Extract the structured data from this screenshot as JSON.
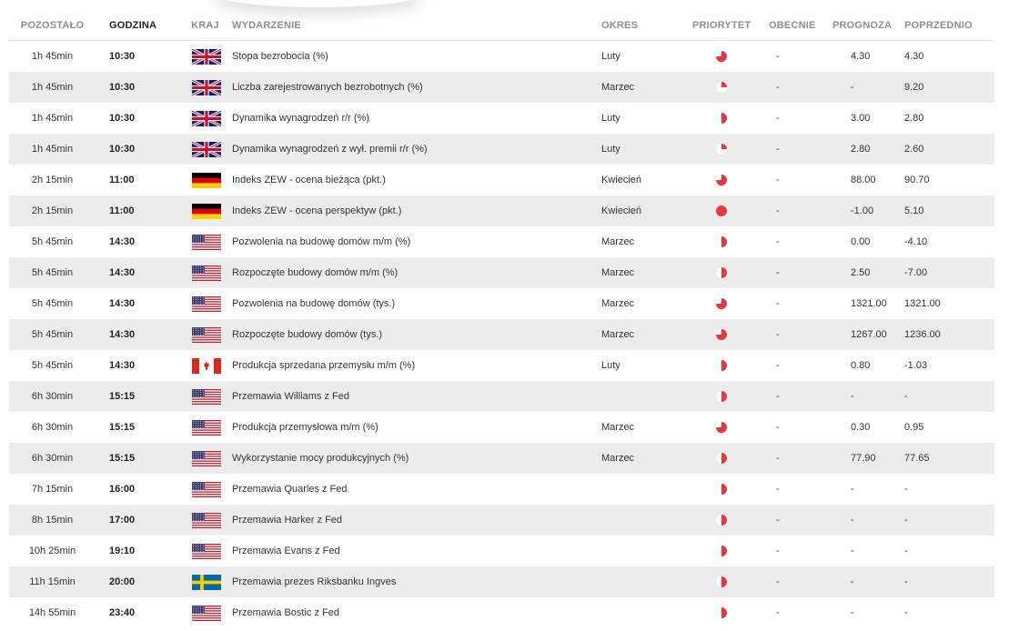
{
  "headers": {
    "remaining": "POZOSTAŁO",
    "time": "GODZINA",
    "country": "KRAJ",
    "event": "WYDARZENIE",
    "period": "OKRES",
    "priority": "PRIORYTET",
    "actual": "OBECNIE",
    "forecast": "PROGNOZA",
    "previous": "POPRZEDNIO"
  },
  "colors": {
    "priority_red": "#e8373e",
    "row_alt": "#ececed",
    "header_text": "#8a8f96"
  },
  "events": [
    {
      "remaining": "1h 45min",
      "time": "10:30",
      "country": "GB",
      "flag_icon": "uk-flag-icon",
      "event": "Stopa bezrobocia (%)",
      "period": "Luty",
      "priority": 0.75,
      "actual": "-",
      "forecast": "4.30",
      "previous": "4.30"
    },
    {
      "remaining": "1h 45min",
      "time": "10:30",
      "country": "GB",
      "flag_icon": "uk-flag-icon",
      "event": "Liczba zarejestrowanych bezrobotnych (%)",
      "period": "Marzec",
      "priority": 0.25,
      "actual": "-",
      "forecast": "-",
      "previous": "9.20"
    },
    {
      "remaining": "1h 45min",
      "time": "10:30",
      "country": "GB",
      "flag_icon": "uk-flag-icon",
      "event": "Dynamika wynagrodzeń r/r (%)",
      "period": "Luty",
      "priority": 0.5,
      "actual": "-",
      "forecast": "3.00",
      "previous": "2.80"
    },
    {
      "remaining": "1h 45min",
      "time": "10:30",
      "country": "GB",
      "flag_icon": "uk-flag-icon",
      "event": "Dynamika wynagrodzeń z wył. premii r/r (%)",
      "period": "Luty",
      "priority": 0.25,
      "actual": "-",
      "forecast": "2.80",
      "previous": "2.60"
    },
    {
      "remaining": "2h 15min",
      "time": "11:00",
      "country": "DE",
      "flag_icon": "germany-flag-icon",
      "event": "Indeks ZEW - ocena bieżąca (pkt.)",
      "period": "Kwiecień",
      "priority": 0.75,
      "actual": "-",
      "forecast": "88.00",
      "previous": "90.70"
    },
    {
      "remaining": "2h 15min",
      "time": "11:00",
      "country": "DE",
      "flag_icon": "germany-flag-icon",
      "event": "Indeks ZEW - ocena perspektyw (pkt.)",
      "period": "Kwiecień",
      "priority": 1,
      "actual": "-",
      "forecast": "-1.00",
      "previous": "5.10"
    },
    {
      "remaining": "5h 45min",
      "time": "14:30",
      "country": "US",
      "flag_icon": "usa-flag-icon",
      "event": "Pozwolenia na budowę domów m/m (%)",
      "period": "Marzec",
      "priority": 0.5,
      "actual": "-",
      "forecast": "0.00",
      "previous": "-4.10"
    },
    {
      "remaining": "5h 45min",
      "time": "14:30",
      "country": "US",
      "flag_icon": "usa-flag-icon",
      "event": "Rozpoczęte budowy domów m/m (%)",
      "period": "Marzec",
      "priority": 0.5,
      "actual": "-",
      "forecast": "2.50",
      "previous": "-7.00"
    },
    {
      "remaining": "5h 45min",
      "time": "14:30",
      "country": "US",
      "flag_icon": "usa-flag-icon",
      "event": "Pozwolenia na budowę domów (tys.)",
      "period": "Marzec",
      "priority": 0.75,
      "actual": "-",
      "forecast": "1321.00",
      "previous": "1321.00"
    },
    {
      "remaining": "5h 45min",
      "time": "14:30",
      "country": "US",
      "flag_icon": "usa-flag-icon",
      "event": "Rozpoczęte budowy domów (tys.)",
      "period": "Marzec",
      "priority": 0.75,
      "actual": "-",
      "forecast": "1267.00",
      "previous": "1236.00"
    },
    {
      "remaining": "5h 45min",
      "time": "14:30",
      "country": "CA",
      "flag_icon": "canada-flag-icon",
      "event": "Produkcja sprzedana przemysłu m/m (%)",
      "period": "Luty",
      "priority": 0.5,
      "actual": "-",
      "forecast": "0.80",
      "previous": "-1.03"
    },
    {
      "remaining": "6h 30min",
      "time": "15:15",
      "country": "US",
      "flag_icon": "usa-flag-icon",
      "event": "Przemawia Williams z Fed",
      "period": "",
      "priority": 0.5,
      "actual": "-",
      "forecast": "-",
      "previous": "-"
    },
    {
      "remaining": "6h 30min",
      "time": "15:15",
      "country": "US",
      "flag_icon": "usa-flag-icon",
      "event": "Produkcja przemysłowa m/m (%)",
      "period": "Marzec",
      "priority": 0.75,
      "actual": "-",
      "forecast": "0.30",
      "previous": "0.95"
    },
    {
      "remaining": "6h 30min",
      "time": "15:15",
      "country": "US",
      "flag_icon": "usa-flag-icon",
      "event": "Wykorzystanie mocy produkcyjnych (%)",
      "period": "Marzec",
      "priority": 0.5,
      "actual": "-",
      "forecast": "77.90",
      "previous": "77.65"
    },
    {
      "remaining": "7h 15min",
      "time": "16:00",
      "country": "US",
      "flag_icon": "usa-flag-icon",
      "event": "Przemawia Quarles z Fed",
      "period": "",
      "priority": 0.5,
      "actual": "-",
      "forecast": "-",
      "previous": "-"
    },
    {
      "remaining": "8h 15min",
      "time": "17:00",
      "country": "US",
      "flag_icon": "usa-flag-icon",
      "event": "Przemawia Harker z Fed",
      "period": "",
      "priority": 0.5,
      "actual": "-",
      "forecast": "-",
      "previous": "-"
    },
    {
      "remaining": "10h 25min",
      "time": "19:10",
      "country": "US",
      "flag_icon": "usa-flag-icon",
      "event": "Przemawia Evans z Fed",
      "period": "",
      "priority": 0.5,
      "actual": "-",
      "forecast": "-",
      "previous": "-"
    },
    {
      "remaining": "11h 15min",
      "time": "20:00",
      "country": "SE",
      "flag_icon": "sweden-flag-icon",
      "event": "Przemawia prezes Riksbanku Ingves",
      "period": "",
      "priority": 0.5,
      "actual": "-",
      "forecast": "-",
      "previous": "-"
    },
    {
      "remaining": "14h 55min",
      "time": "23:40",
      "country": "US",
      "flag_icon": "usa-flag-icon",
      "event": "Przemawia Bostic z Fed",
      "period": "",
      "priority": 0.5,
      "actual": "-",
      "forecast": "-",
      "previous": "-"
    }
  ]
}
